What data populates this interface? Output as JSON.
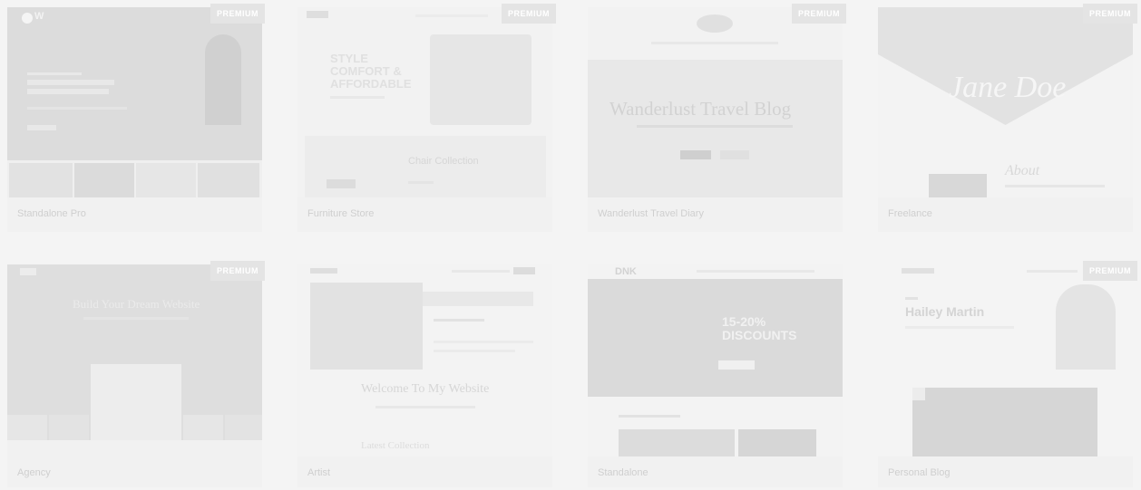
{
  "badge_label": "PREMIUM",
  "cards": [
    {
      "title": "Standalone Pro",
      "premium": true
    },
    {
      "title": "Furniture Store",
      "premium": true
    },
    {
      "title": "Wanderlust Travel Diary",
      "premium": true
    },
    {
      "title": "Freelance",
      "premium": true
    },
    {
      "title": "Agency",
      "premium": true
    },
    {
      "title": "Artist",
      "premium": false
    },
    {
      "title": "Standalone",
      "premium": false
    },
    {
      "title": "Personal Blog",
      "premium": true
    }
  ],
  "previews": {
    "furniture": {
      "headline": "STYLE COMFORT & AFFORDABLE",
      "section": "Chair Collection"
    },
    "wanderlust": {
      "headline": "Wanderlust Travel Blog"
    },
    "freelance": {
      "signature": "Jane Doe",
      "about": "About"
    },
    "agency": {
      "headline": "Build Your Dream Website"
    },
    "artist": {
      "headline": "Welcome To My Website",
      "sub": "Latest Collection"
    },
    "standalone": {
      "brand": "DNK",
      "promo": "15-20% DISCOUNTS"
    },
    "personal": {
      "name": "Hailey Martin"
    }
  },
  "colors": {
    "overlay": "#f4f4f4",
    "badge": "#e4e4e4",
    "card": "#f1f1f1"
  }
}
